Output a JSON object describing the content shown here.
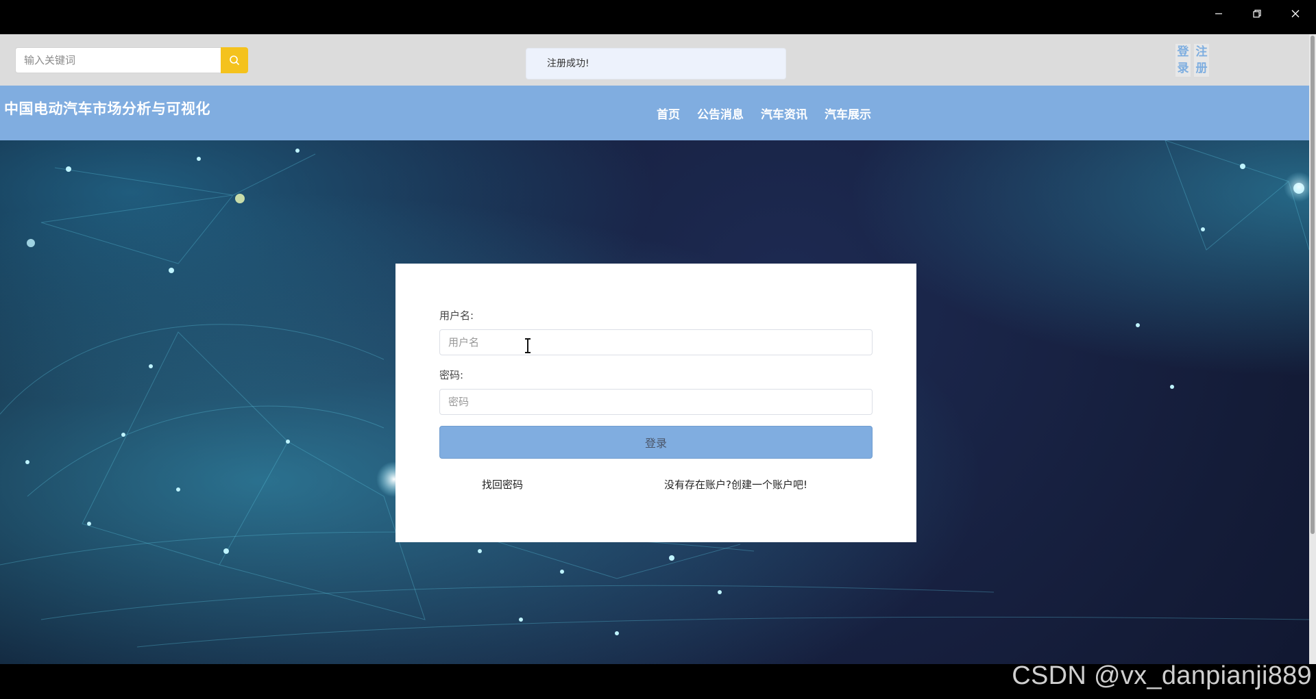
{
  "window": {
    "controls": [
      "minimize-icon",
      "restore-icon",
      "close-icon"
    ]
  },
  "topbar": {
    "search_placeholder": "输入关键词",
    "search_icon": "search-icon",
    "toast": "注册成功!",
    "login_label": "登录",
    "register_label": "注册"
  },
  "nav": {
    "title": "中国电动汽车市场分析与可视化",
    "items": [
      "首页",
      "公告消息",
      "汽车资讯",
      "汽车展示"
    ]
  },
  "login_form": {
    "username_label": "用户名:",
    "username_placeholder": "用户名",
    "password_label": "密码:",
    "password_placeholder": "密码",
    "submit_label": "登录",
    "forgot_link": "找回密码",
    "register_link": "没有存在账户?创建一个账户吧!"
  },
  "watermark": "CSDN @vx_danpianji889",
  "colors": {
    "nav": "#80ade0",
    "search_button": "#f4c21d",
    "hero_bg": "#141c38"
  }
}
